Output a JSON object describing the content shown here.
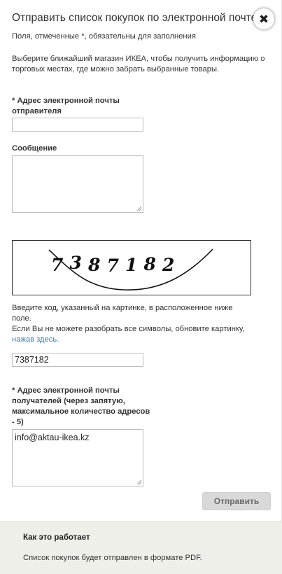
{
  "dialog": {
    "title": "Отправить список покупок по электронной почте",
    "close_symbol": "✖"
  },
  "form": {
    "required_note": "Поля, отмеченные *, обязательны для заполнения",
    "intro": "Выберите ближайший магазин ИКЕА, чтобы получить информацию о торговых местах, где можно забрать выбранные товары.",
    "sender_label": "* Адрес электронной почты отправителя",
    "sender_value": "",
    "message_label": "Сообщение",
    "message_value": "",
    "captcha_code": "7387182",
    "captcha_help_1": "Введите код, указанный на картинке, в расположенное ниже поле.",
    "captcha_help_2": "Если Вы не можете разобрать все символы, обновите картинку,",
    "captcha_refresh_link": "нажав здесь.",
    "code_value": "7387182",
    "recipients_label": "* Адрес электронной почты получателей (через запятую, максимальное количество адресов - 5)",
    "recipients_value": "info@aktau-ikea.kz",
    "submit_label": "Отправить"
  },
  "footer": {
    "title": "Как это работает",
    "text": "Список покупок будет отправлен в формате PDF."
  },
  "colors": {
    "link": "#3b7bbf",
    "footer_bg": "#efefea",
    "button_bg": "#d9d9d9"
  }
}
